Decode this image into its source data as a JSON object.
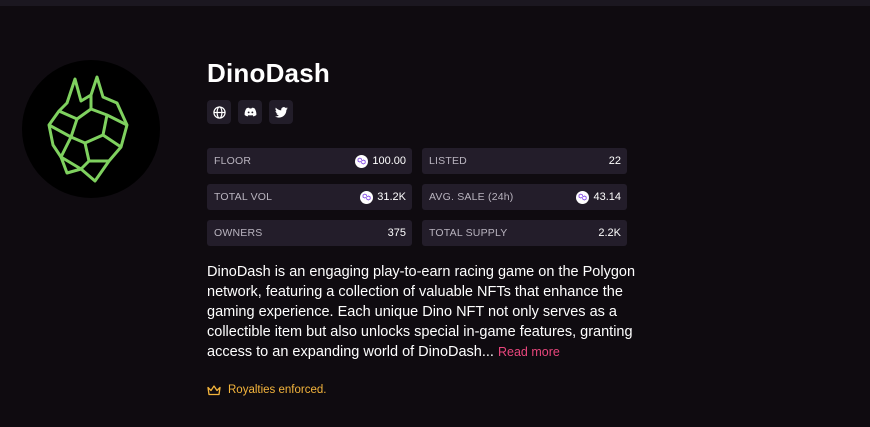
{
  "collection": {
    "name": "DinoDash",
    "description": "DinoDash is an engaging play-to-earn racing game on the Polygon network, featuring a collection of valuable NFTs that enhance the gaming experience. Each unique Dino NFT not only serves as a collectible item but also unlocks special in-game features, granting access to an expanding world of DinoDash...",
    "read_more_label": "Read more",
    "royalties_label": "Royalties enforced."
  },
  "socials": [
    {
      "icon": "globe-icon"
    },
    {
      "icon": "discord-icon"
    },
    {
      "icon": "twitter-icon"
    }
  ],
  "stats": {
    "floor": {
      "label": "FLOOR",
      "value": "100.00",
      "currency_icon": "polygon-matic-icon"
    },
    "listed": {
      "label": "LISTED",
      "value": "22"
    },
    "total_vol": {
      "label": "TOTAL VOL",
      "value": "31.2K",
      "currency_icon": "polygon-matic-icon"
    },
    "avg_sale": {
      "label": "AVG. SALE (24h)",
      "value": "43.14",
      "currency_icon": "polygon-matic-icon"
    },
    "owners": {
      "label": "OWNERS",
      "value": "375"
    },
    "total_supply": {
      "label": "TOTAL SUPPLY",
      "value": "2.2K"
    }
  },
  "colors": {
    "background": "#0f0b10",
    "card": "#231d2a",
    "accent_pink": "#e8467c",
    "royalty_gold": "#f3b43c",
    "logo_green": "#7fd15f"
  }
}
